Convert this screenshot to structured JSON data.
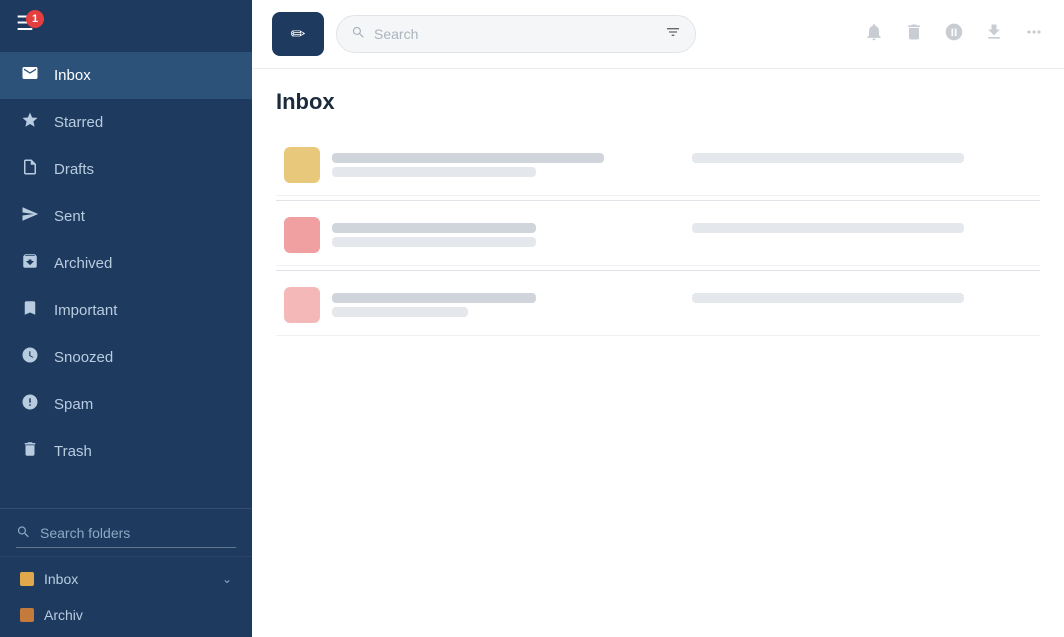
{
  "sidebar": {
    "notification_count": "1",
    "nav_items": [
      {
        "id": "inbox",
        "label": "Inbox",
        "icon": "inbox",
        "active": true
      },
      {
        "id": "starred",
        "label": "Starred",
        "icon": "star"
      },
      {
        "id": "drafts",
        "label": "Drafts",
        "icon": "draft"
      },
      {
        "id": "sent",
        "label": "Sent",
        "icon": "send"
      },
      {
        "id": "archived",
        "label": "Archived",
        "icon": "archive"
      },
      {
        "id": "important",
        "label": "Important",
        "icon": "bookmark"
      },
      {
        "id": "snoozed",
        "label": "Snoozed",
        "icon": "clock"
      },
      {
        "id": "spam",
        "label": "Spam",
        "icon": "spam"
      },
      {
        "id": "trash",
        "label": "Trash",
        "icon": "trash"
      }
    ],
    "search_placeholder": "Search folders",
    "folders": [
      {
        "id": "inbox-folder",
        "label": "Inbox",
        "color": "#e0a84a",
        "has_children": true
      },
      {
        "id": "archiv-folder",
        "label": "Archiv",
        "color": "#c47a3a",
        "has_children": false
      }
    ]
  },
  "topbar": {
    "compose_icon": "✏",
    "search_placeholder": "Search",
    "action_icons": [
      "bell",
      "trash",
      "block",
      "download",
      "more"
    ]
  },
  "main": {
    "title": "Inbox",
    "emails": [
      {
        "id": 1,
        "avatar_color": "#e8c87a"
      },
      {
        "id": 2,
        "avatar_color": "#f0a0a0"
      },
      {
        "id": 3,
        "avatar_color": "#f0b0b0"
      }
    ]
  }
}
